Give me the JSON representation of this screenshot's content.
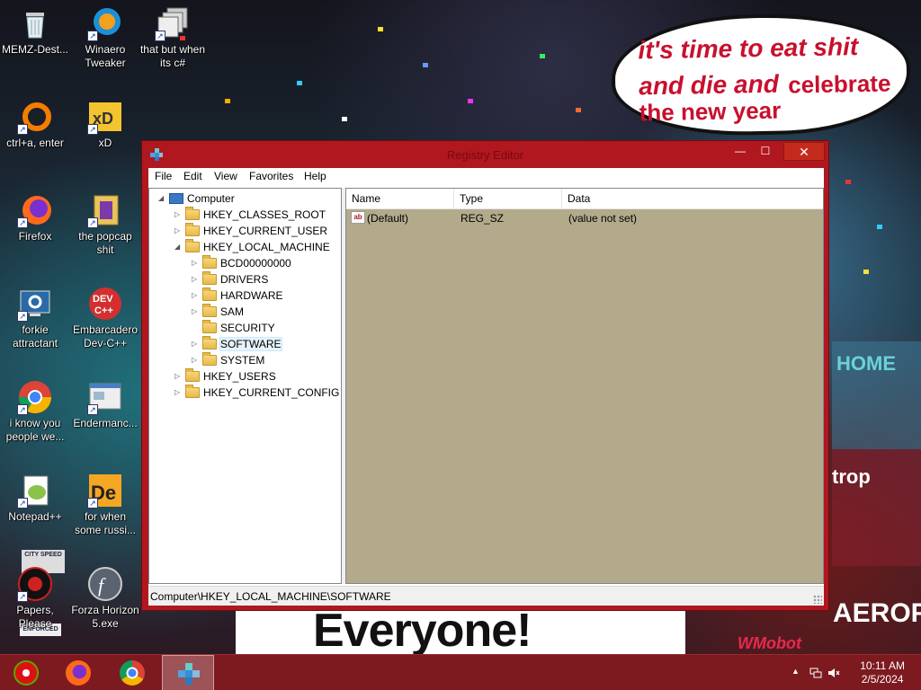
{
  "wallpaper": {
    "speech_bubble": {
      "line1": "it's time to eat shit",
      "line2a": "and die and",
      "line2b": "celebrate",
      "line3": "the new year"
    },
    "banner_text": "Everyone!",
    "sign_text_right": "AEROFOS",
    "sign_text_home": "HOME",
    "sign_text_trop": "trop",
    "badge_text": "WMobot",
    "city_sign": "CITY SPEED",
    "enforced_sign": "ENFORCED"
  },
  "desktop_icons": [
    {
      "label": "MEMZ-Dest...",
      "icon": "recycle-bin-icon"
    },
    {
      "label": "Winaero Tweaker",
      "icon": "winaero-icon"
    },
    {
      "label": "that but when its c#",
      "icon": "stack-icon"
    },
    {
      "label": "ctrl+a, enter",
      "icon": "ring-icon"
    },
    {
      "label": "xD",
      "icon": "hxd-icon"
    },
    {
      "label": "Firefox",
      "icon": "firefox-icon"
    },
    {
      "label": "the popcap shit",
      "icon": "popcap-icon"
    },
    {
      "label": "forkie attractant",
      "icon": "settings-monitor-icon"
    },
    {
      "label": "Embarcadero Dev-C++",
      "icon": "devcpp-icon"
    },
    {
      "label": "i know you people we...",
      "icon": "chrome-icon"
    },
    {
      "label": "Endermanc...",
      "icon": "window-app-icon"
    },
    {
      "label": "Notepad++",
      "icon": "notepadpp-icon"
    },
    {
      "label": "for when some russi...",
      "icon": "de-icon"
    },
    {
      "label": "Papers, Please",
      "icon": "papers-please-icon"
    },
    {
      "label": "Forza Horizon 5.exe",
      "icon": "flash-icon"
    }
  ],
  "window": {
    "title": "Registry Editor",
    "min_glyph": "—",
    "max_glyph": "☐",
    "close_glyph": "✕",
    "menu": [
      "File",
      "Edit",
      "View",
      "Favorites",
      "Help"
    ],
    "tree": {
      "root": "Computer",
      "hives": [
        {
          "label": "HKEY_CLASSES_ROOT"
        },
        {
          "label": "HKEY_CURRENT_USER"
        },
        {
          "label": "HKEY_LOCAL_MACHINE"
        },
        {
          "label": "HKEY_USERS"
        },
        {
          "label": "HKEY_CURRENT_CONFIG"
        }
      ],
      "hklm_children": [
        {
          "label": "BCD00000000"
        },
        {
          "label": "DRIVERS"
        },
        {
          "label": "HARDWARE"
        },
        {
          "label": "SAM"
        },
        {
          "label": "SECURITY"
        },
        {
          "label": "SOFTWARE"
        },
        {
          "label": "SYSTEM"
        }
      ]
    },
    "list": {
      "columns": [
        "Name",
        "Type",
        "Data"
      ],
      "rows": [
        {
          "name": "(Default)",
          "type": "REG_SZ",
          "data": "(value not set)",
          "icon": "string-value-icon"
        }
      ]
    },
    "status_path": "Computer\\HKEY_LOCAL_MACHINE\\SOFTWARE"
  },
  "taskbar": {
    "apps": [
      {
        "name": "memz-icon"
      },
      {
        "name": "firefox-icon"
      },
      {
        "name": "chrome-icon"
      },
      {
        "name": "regedit-icon",
        "active": true
      }
    ],
    "tray_chevron": "▲",
    "time": "10:11 AM",
    "date": "2/5/2024"
  },
  "colors": {
    "window_frame": "#b0171f",
    "taskbar": "#7d1a1f",
    "list_background": "#b3aa8c",
    "bubble_text": "#c8102e"
  }
}
